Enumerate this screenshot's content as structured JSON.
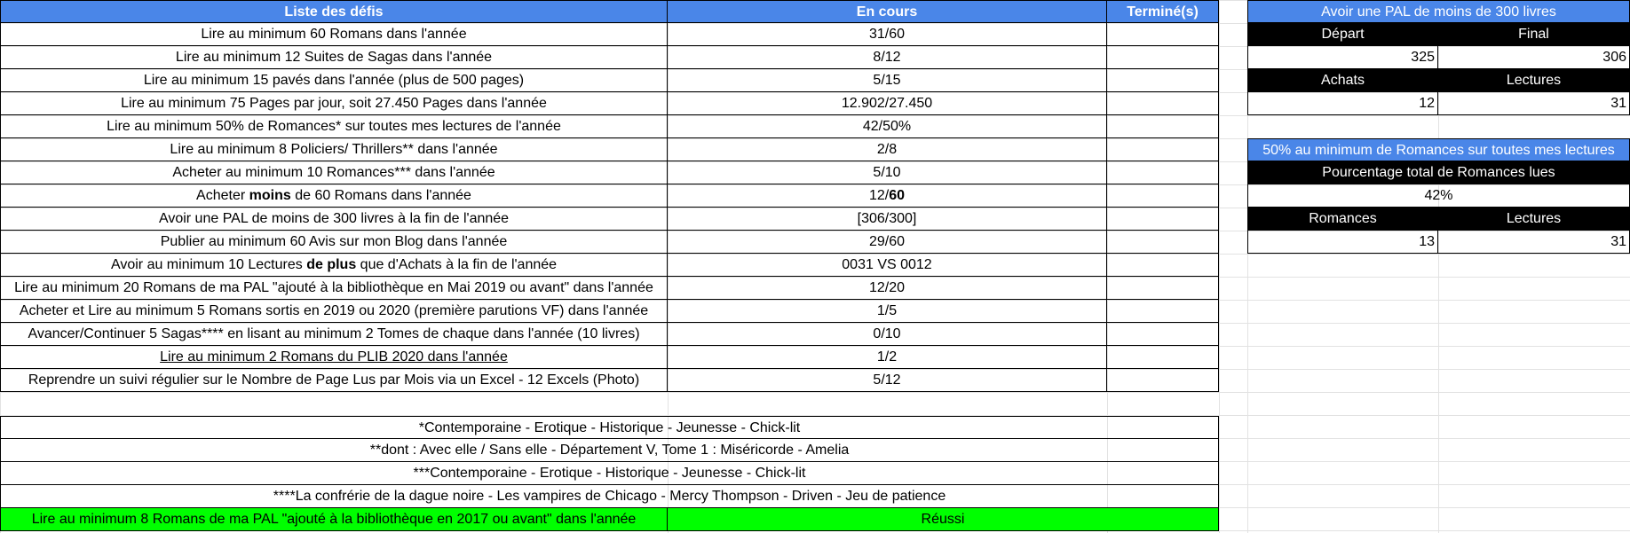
{
  "main_table": {
    "headers": [
      "Liste des défis",
      "En cours",
      "Terminé(s)"
    ],
    "rows": [
      {
        "challenge": "Lire au minimum 60 Romans dans l'année",
        "progress": "31/60",
        "done": ""
      },
      {
        "challenge": "Lire au minimum 12 Suites de Sagas dans l'année",
        "progress": "8/12",
        "done": ""
      },
      {
        "challenge": "Lire au minimum 15 pavés dans l'année (plus de 500 pages)",
        "progress": "5/15",
        "done": ""
      },
      {
        "challenge": "Lire au minimum 75 Pages par jour, soit 27.450 Pages dans l'année",
        "progress": "12.902/27.450",
        "done": ""
      },
      {
        "challenge": "Lire au minimum 50% de Romances* sur toutes mes lectures de l'année",
        "progress": "42/50%",
        "done": ""
      },
      {
        "challenge": "Lire au minimum 8 Policiers/ Thrillers** dans l'année",
        "progress": "2/8",
        "done": ""
      },
      {
        "challenge": "Acheter au minimum 10 Romances*** dans l'année",
        "progress": "5/10",
        "done": ""
      },
      {
        "challenge_pre": "Acheter ",
        "challenge_bold": "moins",
        "challenge_post": " de 60 Romans dans l'année",
        "progress_pre": "12/",
        "progress_bold": "60",
        "done": ""
      },
      {
        "challenge": "Avoir une PAL de moins de 300 livres à la fin de l'année",
        "progress": "[306/300]",
        "done": ""
      },
      {
        "challenge": "Publier au minimum 60 Avis sur mon Blog dans l'année",
        "progress": "29/60",
        "done": ""
      },
      {
        "challenge_pre": "Avoir au minimum 10 Lectures ",
        "challenge_bold": "de plus",
        "challenge_post": " que d'Achats à la fin de l'année",
        "progress": "0031 VS 0012",
        "done": ""
      },
      {
        "challenge": "Lire au minimum 20 Romans de ma PAL \"ajouté à la bibliothèque en Mai 2019 ou avant\" dans l'année",
        "progress": "12/20",
        "done": ""
      },
      {
        "challenge": "Acheter et Lire au minimum 5 Romans sortis en 2019 ou 2020 (première parutions VF) dans l'année",
        "progress": "1/5",
        "done": ""
      },
      {
        "challenge": "Avancer/Continuer 5 Sagas**** en lisant au minimum 2 Tomes de chaque dans l'année (10 livres)",
        "progress": "0/10",
        "done": ""
      },
      {
        "challenge": "Lire au minimum 2 Romans du PLIB 2020 dans l'année",
        "progress": "1/2",
        "done": ""
      },
      {
        "challenge": "Reprendre un suivi régulier sur le Nombre de Page Lus par Mois via un Excel - 12 Excels (Photo)",
        "progress": "5/12",
        "done": ""
      }
    ]
  },
  "footnotes": [
    "*Contemporaine - Erotique - Historique - Jeunesse - Chick-lit",
    "**dont : Avec elle / Sans elle - Département V, Tome 1 : Miséricorde - Amelia",
    "***Contemporaine - Erotique - Historique - Jeunesse - Chick-lit",
    "****La confrérie de la dague noire - Les vampires de Chicago - Mercy Thompson - Driven - Jeu de patience"
  ],
  "completed": {
    "challenge": "Lire au minimum 8 Romans de ma PAL \"ajouté à la bibliothèque en 2017 ou avant\" dans l'année",
    "status": "Réussi"
  },
  "pal_panel": {
    "title": "Avoir une PAL de moins de 300 livres",
    "depart_label": "Départ",
    "final_label": "Final",
    "depart_value": "325",
    "final_value": "306",
    "achats_label": "Achats",
    "lectures_label": "Lectures",
    "achats_value": "12",
    "lectures_value": "31"
  },
  "romance_panel": {
    "title": "50% au minimum de Romances sur toutes mes lectures",
    "subtitle": "Pourcentage total de Romances lues",
    "percentage": "42%",
    "romances_label": "Romances",
    "lectures_label": "Lectures",
    "romances_value": "13",
    "lectures_value": "31"
  },
  "colors": {
    "header_blue": "#4a86e8",
    "success_green": "#00ff00",
    "black": "#000000"
  }
}
